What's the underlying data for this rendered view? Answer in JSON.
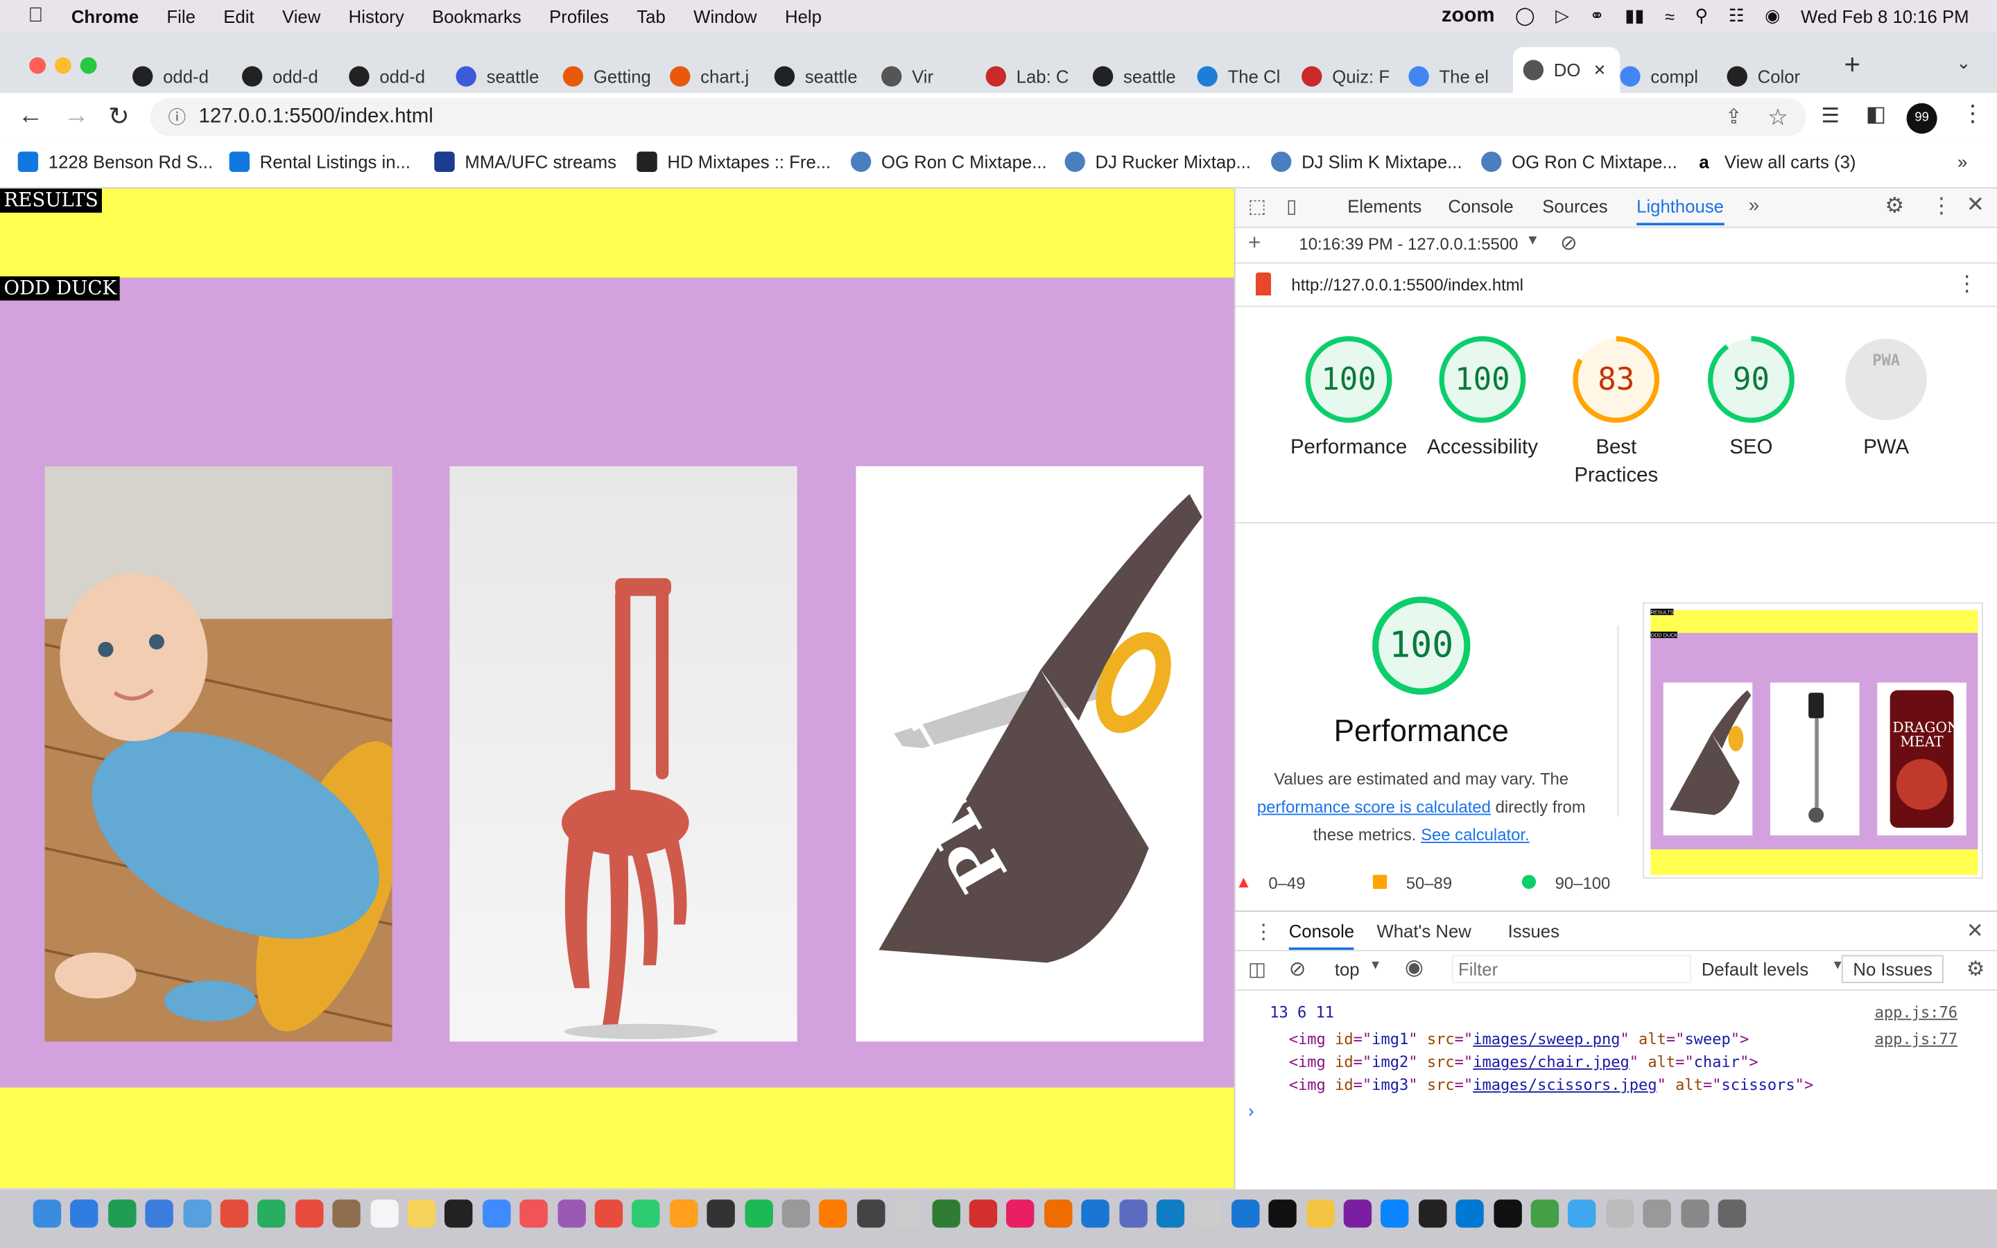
{
  "menubar": {
    "app": "Chrome",
    "items": [
      "File",
      "Edit",
      "View",
      "History",
      "Bookmarks",
      "Profiles",
      "Tab",
      "Window",
      "Help"
    ],
    "zoom_label": "zoom",
    "datetime": "Wed Feb 8  10:16 PM"
  },
  "tabs": [
    {
      "label": "odd-d",
      "color": "#222"
    },
    {
      "label": "odd-d",
      "color": "#222"
    },
    {
      "label": "odd-d",
      "color": "#222"
    },
    {
      "label": "seattle",
      "color": "#3b5bdb"
    },
    {
      "label": "Getting",
      "color": "#e8590c"
    },
    {
      "label": "chart.j",
      "color": "#e8590c"
    },
    {
      "label": "seattle",
      "color": "#222"
    },
    {
      "label": "Vir",
      "color": "#555"
    },
    {
      "label": "Lab: C",
      "color": "#c92a2a"
    },
    {
      "label": "seattle",
      "color": "#222"
    },
    {
      "label": "The Cl",
      "color": "#1c7ed6"
    },
    {
      "label": "Quiz: F",
      "color": "#c92a2a"
    },
    {
      "label": "The el",
      "color": "#4285f4"
    },
    {
      "label": "DO",
      "color": "#555"
    },
    {
      "label": "compl",
      "color": "#4285f4"
    },
    {
      "label": "Color",
      "color": "#222"
    }
  ],
  "toolbar": {
    "url": "127.0.0.1:5500/index.html",
    "profile_badge": "99"
  },
  "bookmarks": [
    "1228 Benson Rd S...",
    "Rental Listings in...",
    "MMA/UFC streams",
    "HD Mixtapes :: Fre...",
    "OG Ron C Mixtape...",
    "DJ Rucker Mixtap...",
    "DJ Slim K Mixtape...",
    "OG Ron C Mixtape...",
    "View all carts (3)"
  ],
  "page": {
    "results_label": "RESULTS",
    "odd_duck_label": "ODD DUCK",
    "products": [
      {
        "name": "sweep"
      },
      {
        "name": "chair"
      },
      {
        "name": "scissors"
      }
    ]
  },
  "devtools": {
    "tabs": [
      "Elements",
      "Console",
      "Sources",
      "Lighthouse"
    ],
    "active_tab": "Lighthouse",
    "report_time": "10:16:39 PM - 127.0.0.1:5500",
    "report_url": "http://127.0.0.1:5500/index.html",
    "gauges": [
      {
        "score": "100",
        "label": "Performance",
        "color": "#0cce6b",
        "value": 100
      },
      {
        "score": "100",
        "label": "Accessibility",
        "color": "#0cce6b",
        "value": 100
      },
      {
        "score": "83",
        "label": "Best Practices",
        "color": "#ffa400",
        "value": 83
      },
      {
        "score": "90",
        "label": "SEO",
        "color": "#0cce6b",
        "value": 90
      },
      {
        "score": "PWA",
        "label": "PWA",
        "color": "#cccccc",
        "value": 0
      }
    ],
    "perf": {
      "score": "100",
      "title": "Performance",
      "desc_1": "Values are estimated and may vary. The",
      "desc_link": "performance score is calculated",
      "desc_2": "directly from",
      "desc_3": "these metrics.",
      "calc_link": "See calculator.",
      "legend": [
        "0–49",
        "50–89",
        "90–100"
      ]
    },
    "thumbnail": {
      "results_label": "RESULTS",
      "odd_duck_label": "ODD DUCK",
      "can_label": "DRAGON MEAT"
    },
    "console": {
      "tabs": [
        "Console",
        "What's New",
        "Issues"
      ],
      "context": "top",
      "filter_placeholder": "Filter",
      "levels": "Default levels",
      "issues": "No Issues",
      "log1": "13 6 11",
      "log1_src": "app.js:76",
      "log2_src": "app.js:77",
      "imgs": [
        {
          "id": "img1",
          "src": "images/sweep.png",
          "alt": "sweep"
        },
        {
          "id": "img2",
          "src": "images/chair.jpeg",
          "alt": "chair"
        },
        {
          "id": "img3",
          "src": "images/scissors.jpeg",
          "alt": "scissors"
        }
      ]
    }
  }
}
